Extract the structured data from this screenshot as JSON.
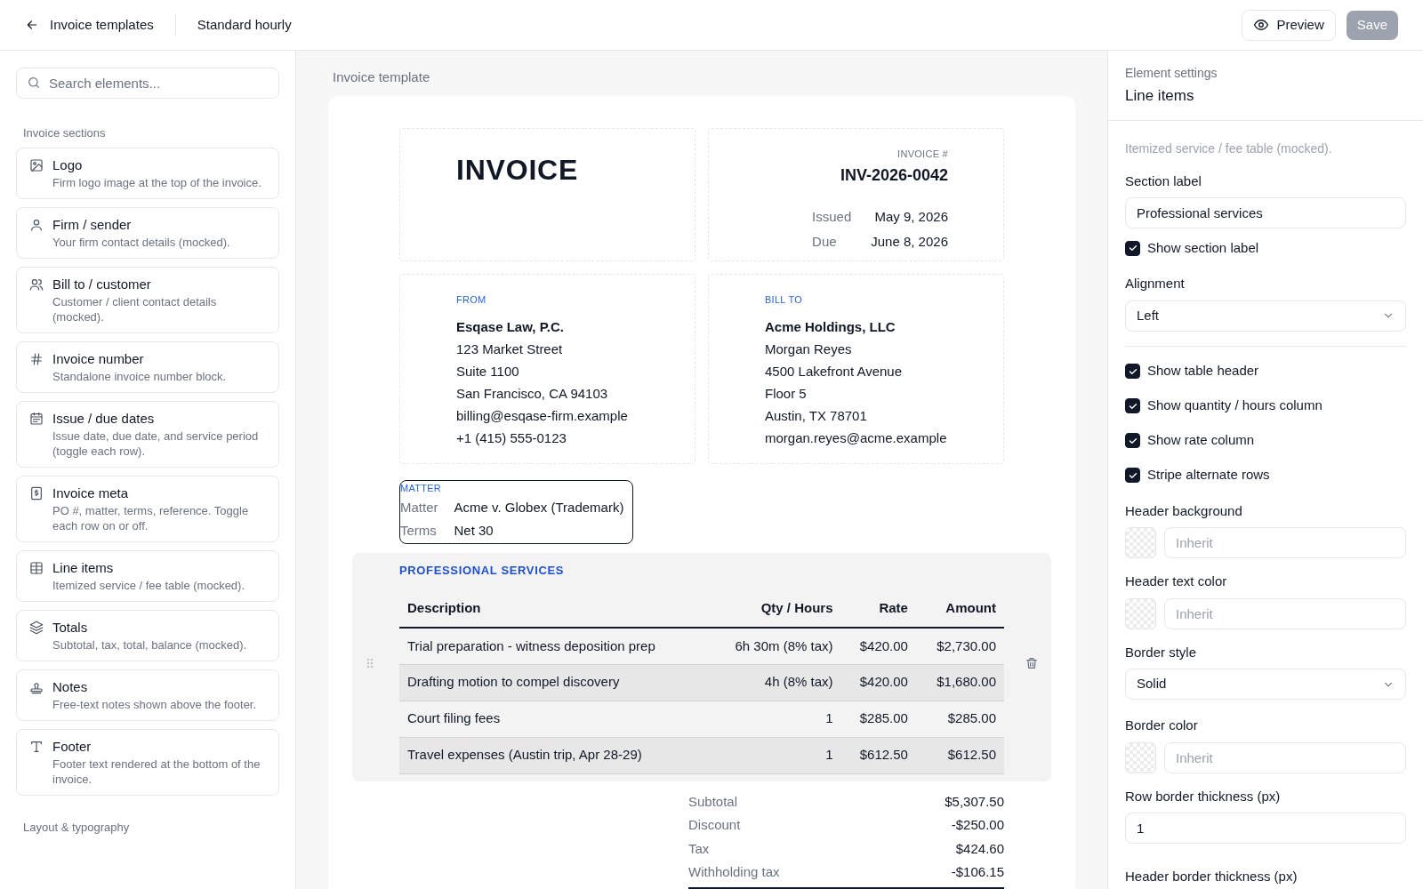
{
  "topbar": {
    "back": "Invoice templates",
    "template_name": "Standard hourly",
    "preview": "Preview",
    "save": "Save",
    "save_disabled": true
  },
  "sidebar": {
    "search_placeholder": "Search elements...",
    "section_title": "Invoice sections",
    "items": [
      {
        "title": "Logo",
        "desc": "Firm logo image at the top of the invoice."
      },
      {
        "title": "Firm / sender",
        "desc": "Your firm contact details (mocked)."
      },
      {
        "title": "Bill to / customer",
        "desc": "Customer / client contact details (mocked)."
      },
      {
        "title": "Invoice number",
        "desc": "Standalone invoice number block."
      },
      {
        "title": "Issue / due dates",
        "desc": "Issue date, due date, and service period (toggle each row)."
      },
      {
        "title": "Invoice meta",
        "desc": "PO #, matter, terms, reference. Toggle each row on or off."
      },
      {
        "title": "Line items",
        "desc": "Itemized service / fee table (mocked)."
      },
      {
        "title": "Totals",
        "desc": "Subtotal, tax, total, balance (mocked)."
      },
      {
        "title": "Notes",
        "desc": "Free-text notes shown above the footer."
      },
      {
        "title": "Footer",
        "desc": "Footer text rendered at the bottom of the invoice."
      }
    ],
    "next_section_title": "Layout & typography"
  },
  "canvas": {
    "title": "Invoice template",
    "invoice": {
      "heading": "INVOICE",
      "number_label": "INVOICE #",
      "number": "INV-2026-0042",
      "dates": [
        {
          "label": "Issued",
          "value": "May 9, 2026"
        },
        {
          "label": "Due",
          "value": "June 8, 2026"
        }
      ],
      "parties": [
        {
          "label": "FROM",
          "name": "Esqase Law, P.C.",
          "lines": [
            "123 Market Street",
            "Suite 1100",
            "San Francisco, CA 94103",
            "billing@esqase-firm.example",
            "+1 (415) 555-0123"
          ]
        },
        {
          "label": "BILL TO",
          "name": "Acme Holdings, LLC",
          "lines": [
            "Morgan Reyes",
            "4500 Lakefront Avenue",
            "Floor 5",
            "Austin, TX 78701",
            "morgan.reyes@acme.example"
          ]
        }
      ],
      "meta": {
        "label": "MATTER",
        "highlighted": true,
        "rows": [
          {
            "label": "Matter",
            "value": "Acme v. Globex (Trademark)"
          },
          {
            "label": "Terms",
            "value": "Net 30"
          }
        ]
      },
      "line_items": {
        "selected": true,
        "label": "PROFESSIONAL SERVICES",
        "columns": [
          "Description",
          "Qty / Hours",
          "Rate",
          "Amount"
        ],
        "rows": [
          {
            "shaded": false,
            "cells": [
              "Trial preparation - witness deposition prep",
              "6h 30m (8% tax)",
              "$420.00",
              "$2,730.00"
            ]
          },
          {
            "shaded": true,
            "cells": [
              "Drafting motion to compel discovery",
              "4h (8% tax)",
              "$420.00",
              "$1,680.00"
            ]
          },
          {
            "shaded": false,
            "cells": [
              "Court filing fees",
              "1",
              "$285.00",
              "$285.00"
            ]
          },
          {
            "shaded": true,
            "cells": [
              "Travel expenses (Austin trip, Apr 28-29)",
              "1",
              "$612.50",
              "$612.50"
            ]
          }
        ]
      },
      "totals": [
        {
          "label": "Subtotal",
          "value": "$5,307.50"
        },
        {
          "label": "Discount",
          "value": "-$250.00"
        },
        {
          "label": "Tax",
          "value": "$424.60"
        },
        {
          "label": "Withholding tax",
          "value": "-$106.15"
        }
      ]
    }
  },
  "settings": {
    "caption": "Element settings",
    "title": "Line items",
    "description": "Itemized service / fee table (mocked).",
    "fields": [
      {
        "kind": "text",
        "label": "Section label",
        "value": "Professional services"
      },
      {
        "kind": "checkbox",
        "label": "Show section label",
        "checked": true
      },
      {
        "kind": "select",
        "label": "Alignment",
        "value": "Left"
      },
      {
        "kind": "divider"
      },
      {
        "kind": "checkbox",
        "label": "Show table header",
        "checked": true
      },
      {
        "kind": "checkbox",
        "label": "Show quantity / hours column",
        "checked": true
      },
      {
        "kind": "checkbox",
        "label": "Show rate column",
        "checked": true
      },
      {
        "kind": "checkbox",
        "label": "Stripe alternate rows",
        "checked": true
      },
      {
        "kind": "color",
        "label": "Header background",
        "placeholder": "Inherit"
      },
      {
        "kind": "color",
        "label": "Header text color",
        "placeholder": "Inherit"
      },
      {
        "kind": "select",
        "label": "Border style",
        "value": "Solid"
      },
      {
        "kind": "color",
        "label": "Border color",
        "placeholder": "Inherit"
      },
      {
        "kind": "text",
        "label": "Row border thickness (px)",
        "value": "1"
      },
      {
        "kind": "label",
        "label": "Header border thickness (px)"
      }
    ]
  }
}
